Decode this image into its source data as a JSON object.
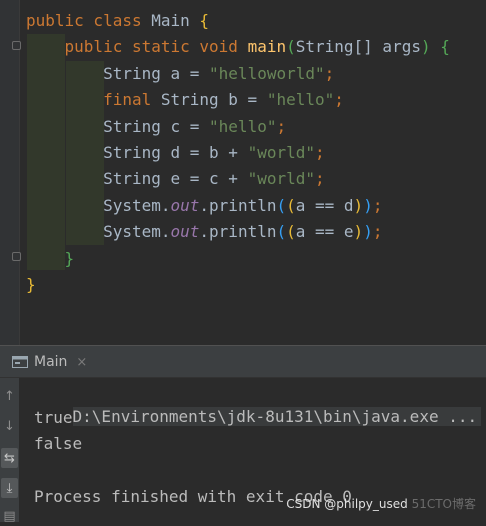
{
  "editor": {
    "lines": [
      {
        "t": [
          {
            "c": "kw",
            "v": "public class "
          },
          {
            "c": "",
            "v": "Main "
          },
          {
            "c": "br1",
            "v": "{"
          }
        ]
      },
      {
        "t": [
          {
            "c": "kw",
            "v": "    public static void "
          },
          {
            "c": "fn",
            "v": "main"
          },
          {
            "c": "br2",
            "v": "("
          },
          {
            "c": "",
            "v": "String[] args"
          },
          {
            "c": "br2",
            "v": ")"
          },
          {
            "c": "",
            "v": " "
          },
          {
            "c": "br2",
            "v": "{"
          }
        ]
      },
      {
        "t": [
          {
            "c": "",
            "v": "        String a = "
          },
          {
            "c": "str",
            "v": "\"helloworld\""
          },
          {
            "c": "kw",
            "v": ";"
          }
        ]
      },
      {
        "t": [
          {
            "c": "kw",
            "v": "        final "
          },
          {
            "c": "",
            "v": "String b = "
          },
          {
            "c": "str",
            "v": "\"hello\""
          },
          {
            "c": "kw",
            "v": ";"
          }
        ]
      },
      {
        "t": [
          {
            "c": "",
            "v": "        String c = "
          },
          {
            "c": "str",
            "v": "\"hello\""
          },
          {
            "c": "kw",
            "v": ";"
          }
        ]
      },
      {
        "t": [
          {
            "c": "",
            "v": "        String d = b + "
          },
          {
            "c": "str",
            "v": "\"world\""
          },
          {
            "c": "kw",
            "v": ";"
          }
        ]
      },
      {
        "t": [
          {
            "c": "",
            "v": "        String e = c + "
          },
          {
            "c": "str",
            "v": "\"world\""
          },
          {
            "c": "kw",
            "v": ";"
          }
        ]
      },
      {
        "t": [
          {
            "c": "",
            "v": "        System."
          },
          {
            "c": "fld",
            "v": "out"
          },
          {
            "c": "",
            "v": ".println"
          },
          {
            "c": "br3",
            "v": "("
          },
          {
            "c": "br1",
            "v": "("
          },
          {
            "c": "",
            "v": "a == d"
          },
          {
            "c": "br1",
            "v": ")"
          },
          {
            "c": "br3",
            "v": ")"
          },
          {
            "c": "kw",
            "v": ";"
          }
        ]
      },
      {
        "t": [
          {
            "c": "",
            "v": "        System."
          },
          {
            "c": "fld",
            "v": "out"
          },
          {
            "c": "",
            "v": ".println"
          },
          {
            "c": "br3",
            "v": "("
          },
          {
            "c": "br1",
            "v": "("
          },
          {
            "c": "",
            "v": "a == e"
          },
          {
            "c": "br1",
            "v": ")"
          },
          {
            "c": "br3",
            "v": ")"
          },
          {
            "c": "kw",
            "v": ";"
          }
        ]
      },
      {
        "t": [
          {
            "c": "br2",
            "v": "    }"
          }
        ]
      },
      {
        "t": [
          {
            "c": "br1",
            "v": "}"
          }
        ]
      }
    ]
  },
  "run_panel": {
    "tab_label": "Main",
    "close_glyph": "×",
    "icons": [
      "rerun-up-icon",
      "down-arrow-icon",
      "soft-wrap-icon",
      "scroll-to-end-icon",
      "print-icon"
    ]
  },
  "console": {
    "command": "D:\\Environments\\jdk-8u131\\bin\\java.exe ...",
    "output": [
      "true",
      "false"
    ],
    "finish": "Process finished with exit code 0"
  },
  "watermark": {
    "text": "CSDN @philpy_used",
    "faint": "51CTO博客"
  },
  "colors": {
    "background": "#2b2b2b",
    "keyword": "#cc7832",
    "string": "#6a8759",
    "method": "#ffc66d",
    "field": "#9876aa"
  }
}
